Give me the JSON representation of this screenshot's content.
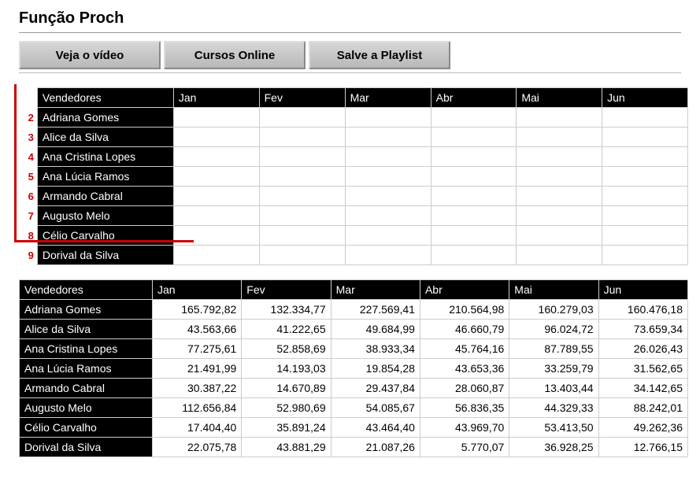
{
  "title": "Função Proch",
  "toolbar": {
    "btn1": "Veja o vídeo",
    "btn2": "Cursos Online",
    "btn3": "Salve a Playlist"
  },
  "columns": {
    "vendedores": "Vendedores",
    "months": [
      "Jan",
      "Fev",
      "Mar",
      "Abr",
      "Mai",
      "Jun"
    ]
  },
  "table1": {
    "start_rownum": 2,
    "vendedores": [
      "Adriana Gomes",
      "Alice da Silva",
      "Ana Cristina Lopes",
      "Ana Lúcia Ramos",
      "Armando Cabral",
      "Augusto Melo",
      "Célio Carvalho",
      "Dorival da Silva"
    ]
  },
  "table2": {
    "rows": [
      {
        "vendedor": "Adriana Gomes",
        "vals": [
          "165.792,82",
          "132.334,77",
          "227.569,41",
          "210.564,98",
          "160.279,03",
          "160.476,18"
        ]
      },
      {
        "vendedor": "Alice da Silva",
        "vals": [
          "43.563,66",
          "41.222,65",
          "49.684,99",
          "46.660,79",
          "96.024,72",
          "73.659,34"
        ]
      },
      {
        "vendedor": "Ana Cristina Lopes",
        "vals": [
          "77.275,61",
          "52.858,69",
          "38.933,34",
          "45.764,16",
          "87.789,55",
          "26.026,43"
        ]
      },
      {
        "vendedor": "Ana Lúcia Ramos",
        "vals": [
          "21.491,99",
          "14.193,03",
          "19.854,28",
          "43.653,36",
          "33.259,79",
          "31.562,65"
        ]
      },
      {
        "vendedor": "Armando Cabral",
        "vals": [
          "30.387,22",
          "14.670,89",
          "29.437,84",
          "28.060,87",
          "13.403,44",
          "34.142,65"
        ]
      },
      {
        "vendedor": "Augusto Melo",
        "vals": [
          "112.656,84",
          "52.980,69",
          "54.085,67",
          "56.836,35",
          "44.329,33",
          "88.242,01"
        ]
      },
      {
        "vendedor": "Célio Carvalho",
        "vals": [
          "17.404,40",
          "35.891,24",
          "43.464,40",
          "43.969,70",
          "53.413,50",
          "49.262,36"
        ]
      },
      {
        "vendedor": "Dorival da Silva",
        "vals": [
          "22.075,78",
          "43.881,29",
          "21.087,26",
          "5.770,07",
          "36.928,25",
          "12.766,15"
        ]
      }
    ]
  },
  "chart_data": {
    "type": "table",
    "title": "Função Proch",
    "categories": [
      "Jan",
      "Fev",
      "Mar",
      "Abr",
      "Mai",
      "Jun"
    ],
    "series": [
      {
        "name": "Adriana Gomes",
        "values": [
          165792.82,
          132334.77,
          227569.41,
          210564.98,
          160279.03,
          160476.18
        ]
      },
      {
        "name": "Alice da Silva",
        "values": [
          43563.66,
          41222.65,
          49684.99,
          46660.79,
          96024.72,
          73659.34
        ]
      },
      {
        "name": "Ana Cristina Lopes",
        "values": [
          77275.61,
          52858.69,
          38933.34,
          45764.16,
          87789.55,
          26026.43
        ]
      },
      {
        "name": "Ana Lúcia Ramos",
        "values": [
          21491.99,
          14193.03,
          19854.28,
          43653.36,
          33259.79,
          31562.65
        ]
      },
      {
        "name": "Armando Cabral",
        "values": [
          30387.22,
          14670.89,
          29437.84,
          28060.87,
          13403.44,
          34142.65
        ]
      },
      {
        "name": "Augusto Melo",
        "values": [
          112656.84,
          52980.69,
          54085.67,
          56836.35,
          44329.33,
          88242.01
        ]
      },
      {
        "name": "Célio Carvalho",
        "values": [
          17404.4,
          35891.24,
          43464.4,
          43969.7,
          53413.5,
          49262.36
        ]
      },
      {
        "name": "Dorival da Silva",
        "values": [
          22075.78,
          43881.29,
          21087.26,
          5770.07,
          36928.25,
          12766.15
        ]
      }
    ]
  }
}
